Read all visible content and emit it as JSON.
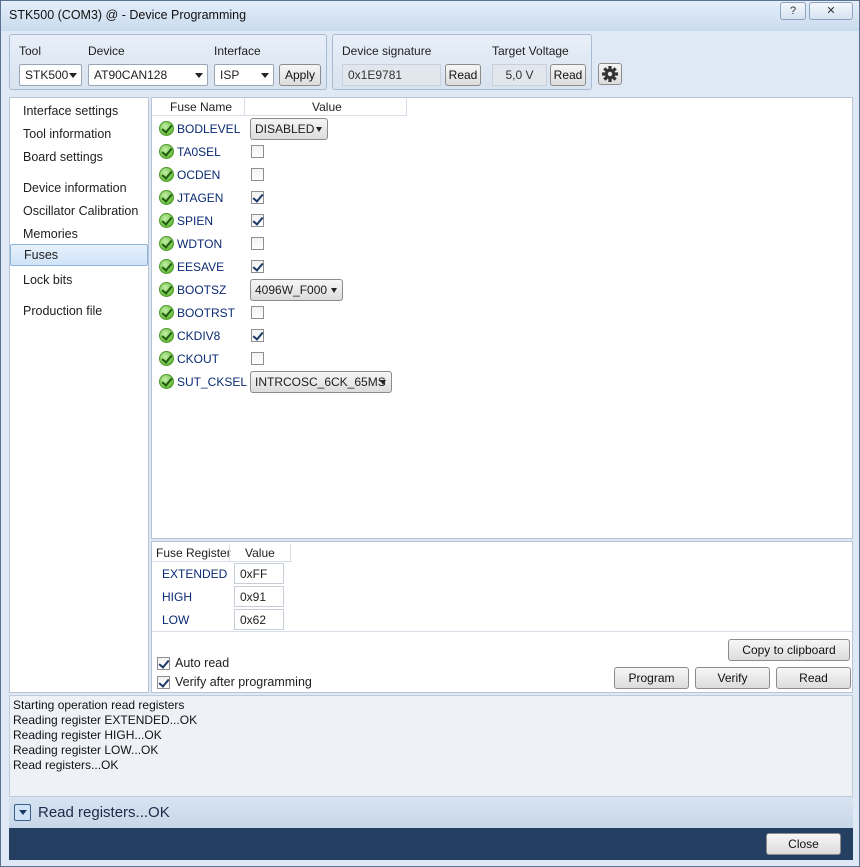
{
  "window": {
    "title": "STK500 (COM3) @  - Device Programming",
    "help_label": "?",
    "close_label": "✕"
  },
  "toolbar": {
    "tool_label": "Tool",
    "tool_value": "STK500",
    "device_label": "Device",
    "device_value": "AT90CAN128",
    "interface_label": "Interface",
    "interface_value": "ISP",
    "apply_label": "Apply",
    "signature_label": "Device signature",
    "signature_value": "0x1E9781",
    "signature_read_label": "Read",
    "voltage_label": "Target Voltage",
    "voltage_value": "5,0 V",
    "voltage_read_label": "Read",
    "settings_icon": "gear-icon"
  },
  "sidebar": {
    "items": [
      {
        "label": "Interface settings"
      },
      {
        "label": "Tool information"
      },
      {
        "label": "Board settings"
      },
      {
        "label": "Device information"
      },
      {
        "label": "Oscillator Calibration"
      },
      {
        "label": "Memories"
      },
      {
        "label": "Fuses",
        "selected": true
      },
      {
        "label": "Lock bits"
      },
      {
        "label": "Production file"
      }
    ]
  },
  "fuses": {
    "col_name": "Fuse Name",
    "col_value": "Value",
    "rows": [
      {
        "name": "BODLEVEL",
        "type": "select",
        "value": "DISABLED"
      },
      {
        "name": "TA0SEL",
        "type": "check",
        "checked": false
      },
      {
        "name": "OCDEN",
        "type": "check",
        "checked": false
      },
      {
        "name": "JTAGEN",
        "type": "check",
        "checked": true
      },
      {
        "name": "SPIEN",
        "type": "check",
        "checked": true
      },
      {
        "name": "WDTON",
        "type": "check",
        "checked": false
      },
      {
        "name": "EESAVE",
        "type": "check",
        "checked": true
      },
      {
        "name": "BOOTSZ",
        "type": "select",
        "value": "4096W_F000"
      },
      {
        "name": "BOOTRST",
        "type": "check",
        "checked": false
      },
      {
        "name": "CKDIV8",
        "type": "check",
        "checked": true
      },
      {
        "name": "CKOUT",
        "type": "check",
        "checked": false
      },
      {
        "name": "SUT_CKSEL",
        "type": "select",
        "value": "INTRCOSC_6CK_65MS"
      }
    ]
  },
  "registers": {
    "col_name": "Fuse Register",
    "col_value": "Value",
    "rows": [
      {
        "name": "EXTENDED",
        "value": "0xFF"
      },
      {
        "name": "HIGH",
        "value": "0x91"
      },
      {
        "name": "LOW",
        "value": "0x62"
      }
    ]
  },
  "options": {
    "auto_read_label": "Auto read",
    "auto_read_checked": true,
    "verify_label": "Verify after programming",
    "verify_checked": true
  },
  "actions": {
    "copy_label": "Copy to clipboard",
    "program_label": "Program",
    "verify_label": "Verify",
    "read_label": "Read"
  },
  "log": {
    "lines": [
      "Starting operation read registers",
      "Reading register EXTENDED...OK",
      "Reading register HIGH...OK",
      "Reading register LOW...OK",
      "Read registers...OK"
    ]
  },
  "status": {
    "message": "Read registers...OK"
  },
  "footer": {
    "close_label": "Close"
  }
}
